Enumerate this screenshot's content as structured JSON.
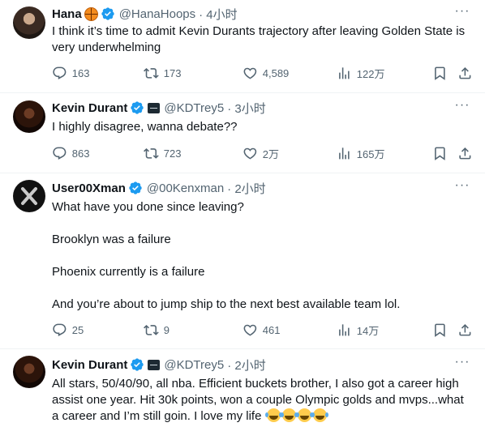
{
  "tweets": [
    {
      "name": "Hana",
      "handle": "@HanaHoops",
      "time": "· 4小时",
      "body": [
        "I think it’s time to admit Kevin Durants trajectory after leaving Golden State is very underwhelming"
      ],
      "replies": "163",
      "retweets": "173",
      "likes": "4,589",
      "views": "122万"
    },
    {
      "name": "Kevin Durant",
      "handle": "@KDTrey5",
      "time": "· 3小时",
      "body": [
        "I highly disagree, wanna debate??"
      ],
      "replies": "863",
      "retweets": "723",
      "likes": "2万",
      "views": "165万"
    },
    {
      "name": "User00Xman",
      "handle": "@00Kenxman",
      "time": "· 2小时",
      "body": [
        "What have you done since leaving?",
        "Brooklyn was a failure",
        "Phoenix currently is a failure",
        "And you’re about to jump ship to the next best available team lol."
      ],
      "replies": "25",
      "retweets": "9",
      "likes": "461",
      "views": "14万"
    },
    {
      "name": "Kevin Durant",
      "handle": "@KDTrey5",
      "time": "· 2小时",
      "body": [
        "All stars, 50/40/90, all nba. Efficient buckets brother, I also got a career high assist one year. Hit 30k points, won a couple Olympic golds and mvps...what a career and I’m still goin. I love my life"
      ]
    }
  ],
  "icons": {
    "more": "more-icon",
    "reply": "reply-icon",
    "retweet": "retweet-icon",
    "like": "like-icon",
    "views": "views-icon",
    "bookmark": "bookmark-icon",
    "share": "share-icon",
    "verified": "verified-badge-icon"
  },
  "colors": {
    "verified": "#1d9bf0",
    "muted": "#536471",
    "text": "#0f1419",
    "divider": "#eff3f4"
  }
}
